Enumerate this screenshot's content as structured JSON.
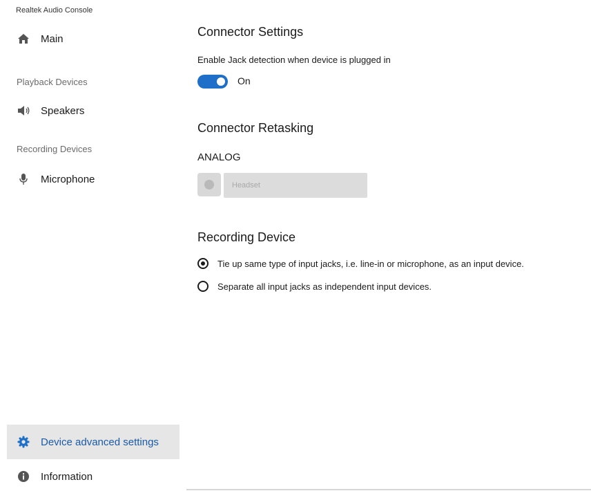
{
  "app": {
    "title": "Realtek Audio Console"
  },
  "sidebar": {
    "main_label": "Main",
    "playback_section": "Playback Devices",
    "speakers_label": "Speakers",
    "recording_section": "Recording Devices",
    "microphone_label": "Microphone",
    "advanced_label": "Device advanced settings",
    "information_label": "Information",
    "icons": {
      "main": "home-icon",
      "speakers": "speaker-icon",
      "microphone": "microphone-icon",
      "advanced": "gear-icon",
      "information": "info-icon"
    }
  },
  "content": {
    "connector_settings_title": "Connector Settings",
    "jack_detection_desc": "Enable Jack detection when device is plugged in",
    "toggle_state_label": "On",
    "toggle_on": true,
    "connector_retasking_title": "Connector Retasking",
    "analog_label": "ANALOG",
    "jack_select_value": "Headset",
    "recording_device_title": "Recording Device",
    "radio_options": [
      {
        "label": "Tie up same type of input jacks, i.e. line-in or microphone, as an input device.",
        "checked": true
      },
      {
        "label": "Separate all input jacks as independent input devices.",
        "checked": false
      }
    ]
  },
  "colors": {
    "accent": "#1f6fc8",
    "selected_bg": "#e6e6e6",
    "selected_text": "#1a5aa8"
  }
}
